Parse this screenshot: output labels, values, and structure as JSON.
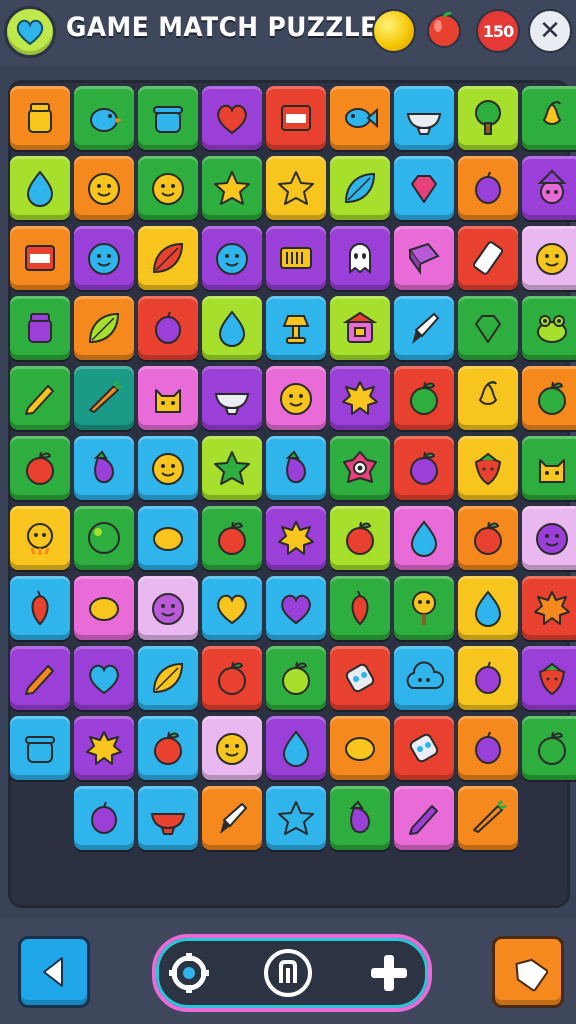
{
  "header": {
    "title": "GAME MATCH PUZZLE",
    "score_badge": "150",
    "close_glyph": "✕"
  },
  "colors": {
    "orange": "#f5891d",
    "green": "#2eae3e",
    "lime": "#a6e02c",
    "purple": "#9a3fd8",
    "red": "#e8412f",
    "yellow": "#f7c51e",
    "cyan": "#2fb4ec",
    "pink": "#e86bd8",
    "lavender": "#e9b8f0",
    "teal": "#1b9a88"
  },
  "board": {
    "rows": [
      [
        {
          "color": "orange",
          "icon": "jar-icon",
          "fill": "#f7c51e"
        },
        {
          "color": "green",
          "icon": "bird-icon",
          "fill": "#2fb4ec"
        },
        {
          "color": "green",
          "icon": "pot-icon",
          "fill": "#2fb4ec"
        },
        {
          "color": "purple",
          "icon": "heart-icon",
          "fill": "#e8412f"
        },
        {
          "color": "red",
          "icon": "flag-icon",
          "fill": "#ffffff"
        },
        {
          "color": "orange",
          "icon": "fish-icon",
          "fill": "#2fb4ec"
        },
        {
          "color": "cyan",
          "icon": "bowl-icon",
          "fill": "#e9ecf2"
        },
        {
          "color": "lime",
          "icon": "tree-icon",
          "fill": "#2eae3e"
        },
        {
          "color": "green",
          "icon": "pear-icon",
          "fill": "#f7c51e"
        }
      ],
      [
        {
          "color": "lime",
          "icon": "drop-icon",
          "fill": "#2fb4ec"
        },
        {
          "color": "orange",
          "icon": "smiley-icon",
          "fill": "#f7c51e"
        },
        {
          "color": "green",
          "icon": "smiley-icon",
          "fill": "#f7c51e"
        },
        {
          "color": "green",
          "icon": "star-icon",
          "fill": "#f7c51e"
        },
        {
          "color": "yellow",
          "icon": "star-icon",
          "fill": "#f7c51e"
        },
        {
          "color": "lime",
          "icon": "leaf-icon",
          "fill": "#2fb4ec"
        },
        {
          "color": "cyan",
          "icon": "gem-icon",
          "fill": "#e8417a"
        },
        {
          "color": "orange",
          "icon": "plum-icon",
          "fill": "#9a3fd8"
        },
        {
          "color": "purple",
          "icon": "witch-icon",
          "fill": "#e86bd8"
        }
      ],
      [
        {
          "color": "orange",
          "icon": "flag-icon",
          "fill": "#ffffff"
        },
        {
          "color": "purple",
          "icon": "smiley-icon",
          "fill": "#2fb4ec"
        },
        {
          "color": "yellow",
          "icon": "leaf-icon",
          "fill": "#e8412f"
        },
        {
          "color": "purple",
          "icon": "smiley-icon",
          "fill": "#2fb4ec"
        },
        {
          "color": "purple",
          "icon": "sign-icon",
          "fill": "#f7c51e"
        },
        {
          "color": "purple",
          "icon": "ghost-icon",
          "fill": "#ffffff"
        },
        {
          "color": "pink",
          "icon": "book-icon",
          "fill": "#b85ad8"
        },
        {
          "color": "red",
          "icon": "phone-icon",
          "fill": "#ffffff"
        },
        {
          "color": "lavender",
          "icon": "smiley-icon",
          "fill": "#f7c51e"
        }
      ],
      [
        {
          "color": "green",
          "icon": "jar-icon",
          "fill": "#9a3fd8"
        },
        {
          "color": "orange",
          "icon": "leaf-icon",
          "fill": "#a6e02c"
        },
        {
          "color": "red",
          "icon": "plum-icon",
          "fill": "#9a3fd8"
        },
        {
          "color": "lime",
          "icon": "drop-icon",
          "fill": "#2fb4ec"
        },
        {
          "color": "cyan",
          "icon": "lamp-icon",
          "fill": "#f7c51e"
        },
        {
          "color": "lime",
          "icon": "shop-icon",
          "fill": "#e86bd8"
        },
        {
          "color": "cyan",
          "icon": "brush-icon",
          "fill": "#ffffff"
        },
        {
          "color": "green",
          "icon": "gem-icon",
          "fill": "#2eae3e"
        },
        {
          "color": "green",
          "icon": "frog-icon",
          "fill": "#a6e02c"
        }
      ],
      [
        {
          "color": "green",
          "icon": "pencil-icon",
          "fill": "#f7c51e"
        },
        {
          "color": "teal",
          "icon": "carrot-icon",
          "fill": "#f5891d"
        },
        {
          "color": "pink",
          "icon": "cat-icon",
          "fill": "#f7c51e"
        },
        {
          "color": "purple",
          "icon": "bowl-icon",
          "fill": "#e9ecf2"
        },
        {
          "color": "pink",
          "icon": "smiley-icon",
          "fill": "#f7c51e"
        },
        {
          "color": "purple",
          "icon": "splat-icon",
          "fill": "#f7c51e"
        },
        {
          "color": "red",
          "icon": "apple-icon",
          "fill": "#2eae3e"
        },
        {
          "color": "yellow",
          "icon": "pear-icon",
          "fill": "#f7c51e"
        },
        {
          "color": "orange",
          "icon": "apple-icon",
          "fill": "#2eae3e"
        }
      ],
      [
        {
          "color": "green",
          "icon": "apple-icon",
          "fill": "#e8412f"
        },
        {
          "color": "cyan",
          "icon": "eggplant-icon",
          "fill": "#9a3fd8"
        },
        {
          "color": "cyan",
          "icon": "smiley-icon",
          "fill": "#f7c51e"
        },
        {
          "color": "lime",
          "icon": "star-icon",
          "fill": "#2eae3e"
        },
        {
          "color": "cyan",
          "icon": "eggplant-icon",
          "fill": "#9a3fd8"
        },
        {
          "color": "green",
          "icon": "eye-icon",
          "fill": "#e8417a"
        },
        {
          "color": "red",
          "icon": "apple-icon",
          "fill": "#9a3fd8"
        },
        {
          "color": "yellow",
          "icon": "strawberry-icon",
          "fill": "#e8412f"
        },
        {
          "color": "green",
          "icon": "cat-icon",
          "fill": "#f7c51e"
        }
      ],
      [
        {
          "color": "yellow",
          "icon": "chick-icon",
          "fill": "#f7c51e"
        },
        {
          "color": "green",
          "icon": "bubble-icon",
          "fill": "#2eae3e"
        },
        {
          "color": "cyan",
          "icon": "lemon-icon",
          "fill": "#f7c51e"
        },
        {
          "color": "green",
          "icon": "apple-icon",
          "fill": "#e8412f"
        },
        {
          "color": "purple",
          "icon": "splat-icon",
          "fill": "#f7c51e"
        },
        {
          "color": "lime",
          "icon": "apple-icon",
          "fill": "#e8412f"
        },
        {
          "color": "pink",
          "icon": "drop-icon",
          "fill": "#2fb4ec"
        },
        {
          "color": "orange",
          "icon": "apple-icon",
          "fill": "#e8412f"
        },
        {
          "color": "lavender",
          "icon": "smiley-icon",
          "fill": "#9a3fd8"
        }
      ],
      [
        {
          "color": "cyan",
          "icon": "pepper-icon",
          "fill": "#e8412f"
        },
        {
          "color": "pink",
          "icon": "lemon-icon",
          "fill": "#f7c51e"
        },
        {
          "color": "lavender",
          "icon": "smiley-icon",
          "fill": "#b85ad8"
        },
        {
          "color": "cyan",
          "icon": "heart-icon",
          "fill": "#f7c51e"
        },
        {
          "color": "cyan",
          "icon": "heart-icon",
          "fill": "#9a3fd8"
        },
        {
          "color": "green",
          "icon": "pepper-icon",
          "fill": "#e8412f"
        },
        {
          "color": "green",
          "icon": "lollipop-icon",
          "fill": "#f7c51e"
        },
        {
          "color": "yellow",
          "icon": "drop-icon",
          "fill": "#2fb4ec"
        },
        {
          "color": "red",
          "icon": "splat-icon",
          "fill": "#f5891d"
        }
      ],
      [
        {
          "color": "purple",
          "icon": "pencil-icon",
          "fill": "#f5891d"
        },
        {
          "color": "purple",
          "icon": "heart-icon",
          "fill": "#2fb4ec"
        },
        {
          "color": "cyan",
          "icon": "leaf-icon",
          "fill": "#f7c51e"
        },
        {
          "color": "red",
          "icon": "apple-icon",
          "fill": "#e8412f"
        },
        {
          "color": "green",
          "icon": "apple-icon",
          "fill": "#a6e02c"
        },
        {
          "color": "red",
          "icon": "robot-icon",
          "fill": "#e9ecf2"
        },
        {
          "color": "cyan",
          "icon": "cloud-icon",
          "fill": "#2fb4ec"
        },
        {
          "color": "yellow",
          "icon": "plum-icon",
          "fill": "#9a3fd8"
        },
        {
          "color": "purple",
          "icon": "strawberry-icon",
          "fill": "#e8412f"
        }
      ],
      [
        {
          "color": "cyan",
          "icon": "pot-icon",
          "fill": "#2fb4ec"
        },
        {
          "color": "purple",
          "icon": "splat-icon",
          "fill": "#f7c51e"
        },
        {
          "color": "cyan",
          "icon": "apple-icon",
          "fill": "#e8412f"
        },
        {
          "color": "lavender",
          "icon": "smiley-icon",
          "fill": "#f7c51e"
        },
        {
          "color": "purple",
          "icon": "drop-icon",
          "fill": "#2fb4ec"
        },
        {
          "color": "orange",
          "icon": "lemon-icon",
          "fill": "#f7c51e"
        },
        {
          "color": "red",
          "icon": "robot-icon",
          "fill": "#e9ecf2"
        },
        {
          "color": "orange",
          "icon": "plum-icon",
          "fill": "#9a3fd8"
        },
        {
          "color": "green",
          "icon": "apple-icon",
          "fill": "#2eae3e"
        }
      ],
      [
        null,
        {
          "color": "cyan",
          "icon": "plum-icon",
          "fill": "#9a3fd8"
        },
        {
          "color": "cyan",
          "icon": "bowl-icon",
          "fill": "#e8412f"
        },
        {
          "color": "orange",
          "icon": "brush-icon",
          "fill": "#ffffff"
        },
        {
          "color": "cyan",
          "icon": "star-icon",
          "fill": "#2fb4ec"
        },
        {
          "color": "green",
          "icon": "eggplant-icon",
          "fill": "#9a3fd8"
        },
        {
          "color": "pink",
          "icon": "pencil-icon",
          "fill": "#9a3fd8"
        },
        {
          "color": "orange",
          "icon": "carrot-icon",
          "fill": "#f5891d"
        },
        null
      ]
    ]
  },
  "controls": {
    "back": "back-arrow-icon",
    "left": "target-icon",
    "middle": "pause-icon",
    "right": "plus-icon",
    "tag": "tag-icon"
  }
}
